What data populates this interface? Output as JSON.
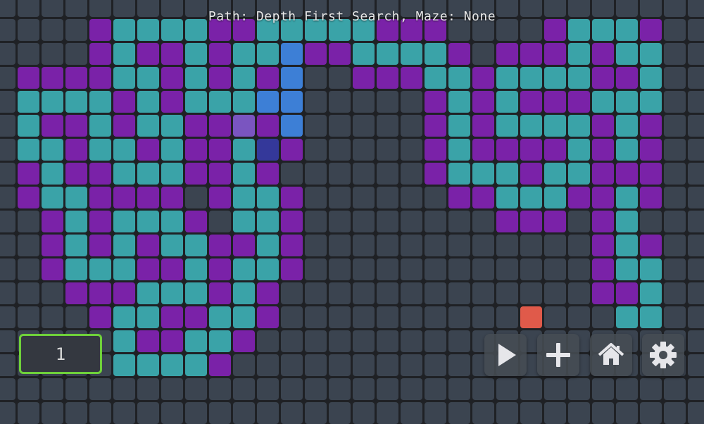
{
  "status_text": "Path: Depth First Search, Maze: None",
  "counter_value": "1",
  "toolbar": [
    {
      "name": "play-button",
      "icon": "play-icon"
    },
    {
      "name": "add-button",
      "icon": "plus-icon"
    },
    {
      "name": "home-button",
      "icon": "home-icon"
    },
    {
      "name": "settings-button",
      "icon": "gear-icon"
    }
  ],
  "colors": {
    "background": "#1f2125",
    "empty": "#3b4450",
    "wall": "#7a22a8",
    "visited": "#3aa3a8",
    "path": "#3d7fd6",
    "start": "#34389a",
    "current": "#7a55c0",
    "target": "#e05a4a",
    "counter_border": "#6fd13a"
  },
  "legend": {
    "E": "empty",
    "W": "wall",
    "T": "visited",
    "B": "path",
    "S": "start",
    "L": "current",
    "R": "target"
  },
  "grid": [
    "EEEWTTTTWWTTTTTWWWEEEEWTTTW",
    "EEEWTWWTWTTBWWTTTTWEWWWTWTT",
    "WWWWTTWTWTWBEEWWWTTWTTTTWWT",
    "TTTTWTWTTTBBEEEEEWTWTWWWTTT",
    "TWWTWTTWWLWBEEEEEWTWTTTTWTW",
    "TTWTTWTWWTSWEEEEEWTWWWWTWTW",
    "WTWWTTTWWTWEEEEEEWTTTWTTWWW",
    "WTTWWWWEWTTWEEEEEEWWTTTWWTW",
    "EWTWTTTWETTWEEEEEEEEWWWEWTE",
    "EWTWTWTTWWTWEEEEEEEEEEEEWTW",
    "EWTTTWWTWTTWEEEEEEEEEEEEWTT",
    "EEWWWTTTWTWEEEEEEEEEEEEEWWT",
    "EEEWTTWWTTWEEEEEEEEEEREEETT",
    "EEEETWWTTWEEEEEEEEEEEEEEEEE",
    "EEEETTTTWEEEEEEEEEEEEEEEEEE"
  ]
}
